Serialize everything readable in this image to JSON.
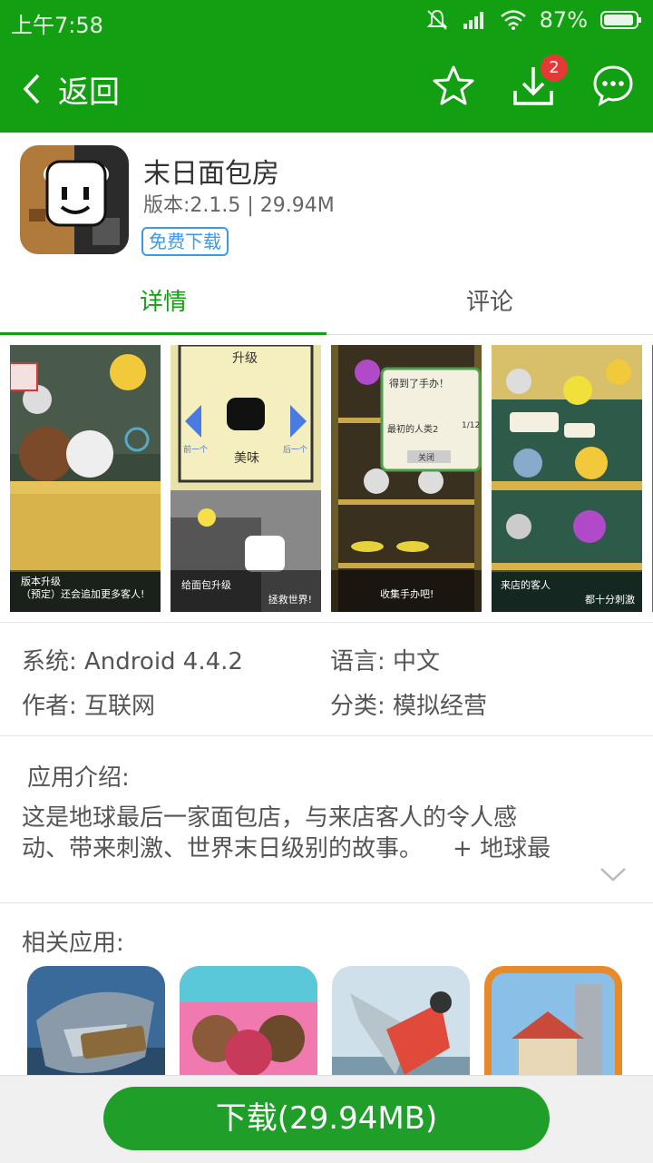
{
  "status_bar": {
    "time": "上午7:58",
    "battery": "87%"
  },
  "app_bar": {
    "back_label": "返回",
    "download_badge": "2"
  },
  "app": {
    "name": "末日面包房",
    "version_size": "版本:2.1.5 | 29.94M",
    "free_label": "免费下载"
  },
  "tabs": [
    {
      "label": "详情"
    },
    {
      "label": "评论"
    }
  ],
  "screenshots": [
    {
      "caption_left": "版本升级\n（预定）还会追加更多客人!",
      "caption_right": ""
    },
    {
      "caption_top": "升级",
      "caption_mid": "美味",
      "nav_left": "前一个",
      "nav_right": "后一个",
      "caption_left": "给面包升级",
      "caption_right": "拯救世界!"
    },
    {
      "dialog_title": "得到了手办！",
      "dialog_item": "最初的人类2",
      "dialog_count": "1/12",
      "dialog_close": "关闭",
      "caption_center": "收集手办吧!"
    },
    {
      "caption_left": "来店的客人",
      "caption_right": "都十分刺激"
    }
  ],
  "info": {
    "system": "系统: Android 4.4.2",
    "language": "语言: 中文",
    "author": "作者: 互联网",
    "category": "分类: 模拟经营"
  },
  "intro": {
    "title": "应用介绍:",
    "line1": "这是地球最后一家面包店，与来店客人的令人感",
    "line2": "动、带来刺激、世界末日级别的故事。    + 地球最"
  },
  "related": {
    "title": "相关应用:"
  },
  "download_button": "下载(29.94MB)",
  "colors": {
    "brand_green": "#12a012",
    "link_blue": "#3a9be8",
    "badge_red": "#e53935"
  }
}
